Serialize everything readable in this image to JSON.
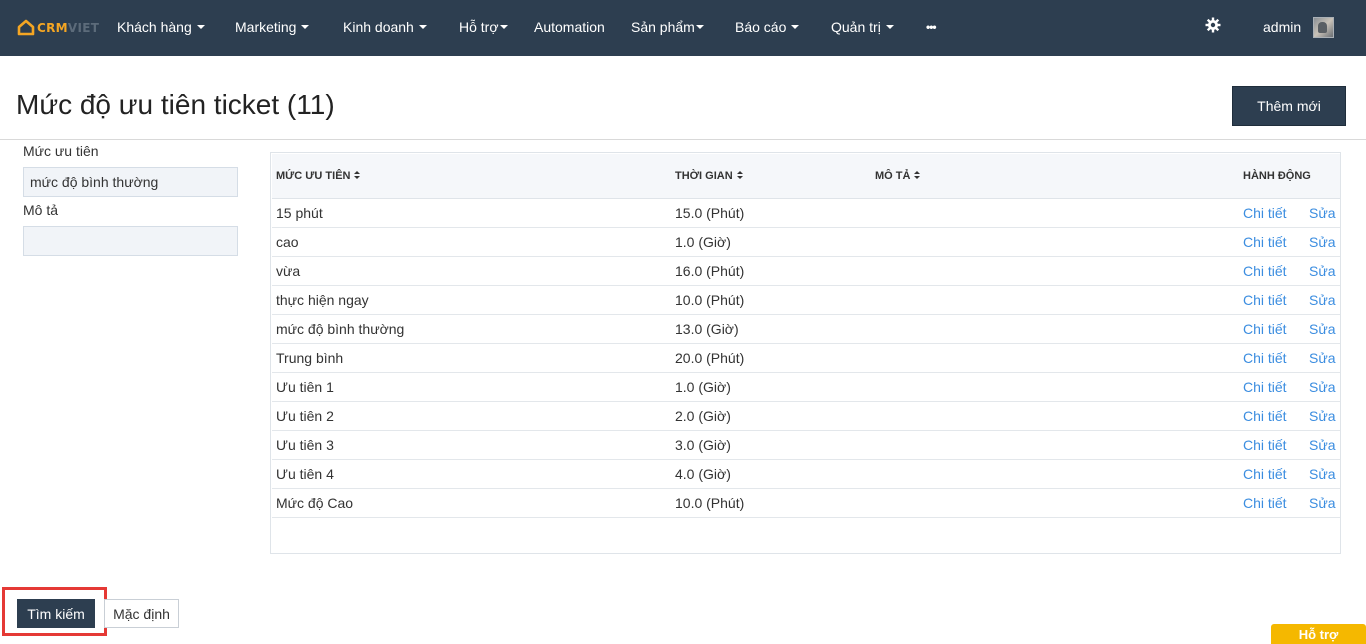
{
  "brand": {
    "crm": "CRM",
    "viet": "VIET",
    "accent": "#f5a623"
  },
  "nav": {
    "items": [
      {
        "label": "Khách hàng"
      },
      {
        "label": "Marketing"
      },
      {
        "label": "Kinh doanh"
      },
      {
        "label": "Hỗ trợ"
      },
      {
        "label": "Automation"
      },
      {
        "label": "Sản phẩm"
      },
      {
        "label": "Báo cáo"
      },
      {
        "label": "Quản trị"
      }
    ],
    "more": "•••",
    "settings_icon": "gear-icon",
    "user": "admin",
    "bg_color": "#2d3e50"
  },
  "page": {
    "title": "Mức độ ưu tiên ticket (11)",
    "add_button": "Thêm mới"
  },
  "filters": {
    "priority_label": "Mức ưu tiên",
    "priority_value": "mức độ bình thường",
    "description_label": "Mô tả",
    "description_value": ""
  },
  "table": {
    "headers": {
      "priority": "MỨC ƯU TIÊN",
      "time": "THỜI GIAN",
      "description": "MÔ TẢ",
      "actions": "HÀNH ĐỘNG"
    },
    "rows": [
      {
        "priority": "15 phút",
        "time": "15.0 (Phút)",
        "description": "",
        "detail": "Chi tiết",
        "edit": "Sửa"
      },
      {
        "priority": "cao",
        "time": "1.0 (Giờ)",
        "description": "",
        "detail": "Chi tiết",
        "edit": "Sửa"
      },
      {
        "priority": "vừa",
        "time": "16.0 (Phút)",
        "description": "",
        "detail": "Chi tiết",
        "edit": "Sửa"
      },
      {
        "priority": "thực hiện ngay",
        "time": "10.0 (Phút)",
        "description": "",
        "detail": "Chi tiết",
        "edit": "Sửa"
      },
      {
        "priority": "mức độ bình thường",
        "time": "13.0 (Giờ)",
        "description": "",
        "detail": "Chi tiết",
        "edit": "Sửa"
      },
      {
        "priority": "Trung bình",
        "time": "20.0 (Phút)",
        "description": "",
        "detail": "Chi tiết",
        "edit": "Sửa"
      },
      {
        "priority": "Ưu tiên 1",
        "time": "1.0 (Giờ)",
        "description": "",
        "detail": "Chi tiết",
        "edit": "Sửa"
      },
      {
        "priority": "Ưu tiên 2",
        "time": "2.0 (Giờ)",
        "description": "",
        "detail": "Chi tiết",
        "edit": "Sửa"
      },
      {
        "priority": "Ưu tiên 3",
        "time": "3.0 (Giờ)",
        "description": "",
        "detail": "Chi tiết",
        "edit": "Sửa"
      },
      {
        "priority": "Ưu tiên 4",
        "time": "4.0 (Giờ)",
        "description": "",
        "detail": "Chi tiết",
        "edit": "Sửa"
      },
      {
        "priority": "Mức độ Cao",
        "time": "10.0 (Phút)",
        "description": "",
        "detail": "Chi tiết",
        "edit": "Sửa"
      }
    ]
  },
  "actions": {
    "search": "Tìm kiếm",
    "default": "Mặc định"
  },
  "help": {
    "label": "Hỗ trợ",
    "color": "#f5b800"
  }
}
